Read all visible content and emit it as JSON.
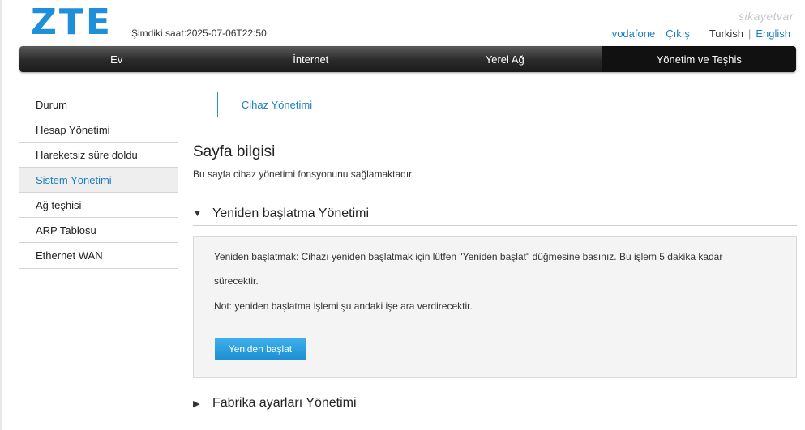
{
  "header": {
    "logo": "ZTE",
    "clock_label": "Şimdiki saat:",
    "clock_value": "2025-07-06T22:50",
    "operator_link": "vodafone",
    "logout_link": "Çıkış",
    "lang_current": "Turkish",
    "lang_separator": "|",
    "lang_other": "English",
    "watermark": "sikayetvar"
  },
  "nav": {
    "items": [
      {
        "label": "Ev"
      },
      {
        "label": "İnternet"
      },
      {
        "label": "Yerel Ağ"
      },
      {
        "label": "Yönetim ve Teşhis"
      }
    ],
    "active_index": 3
  },
  "sidebar": {
    "items": [
      {
        "label": "Durum"
      },
      {
        "label": "Hesap Yönetimi"
      },
      {
        "label": "Hareketsiz süre doldu"
      },
      {
        "label": "Sistem Yönetimi"
      },
      {
        "label": "Ağ teşhisi"
      },
      {
        "label": "ARP Tablosu"
      },
      {
        "label": "Ethernet WAN"
      }
    ],
    "active_index": 3
  },
  "content": {
    "tab_label": "Cihaz Yönetimi",
    "page_title": "Sayfa bilgisi",
    "page_desc": "Bu sayfa cihaz yönetimi fonsyonunu sağlamaktadır.",
    "reboot_section": {
      "arrow": "▼",
      "title": "Yeniden başlatma Yönetimi",
      "text_line1": "Yeniden başlatmak: Cihazı yeniden başlatmak için lütfen \"Yeniden başlat\" düğmesine basınız. Bu işlem 5 dakika kadar",
      "text_line2": "sürecektir.",
      "note": "Not: yeniden başlatma işlemi şu andaki işe ara verdirecektir.",
      "button_label": "Yeniden başlat"
    },
    "factory_section": {
      "arrow": "▶",
      "title": "Fabrika ayarları Yönetimi"
    }
  },
  "colors": {
    "accent": "#1a7ec4",
    "logo": "#1e8fd8",
    "nav_dark": "#1c1c1c",
    "button": "#1b8fd3"
  }
}
